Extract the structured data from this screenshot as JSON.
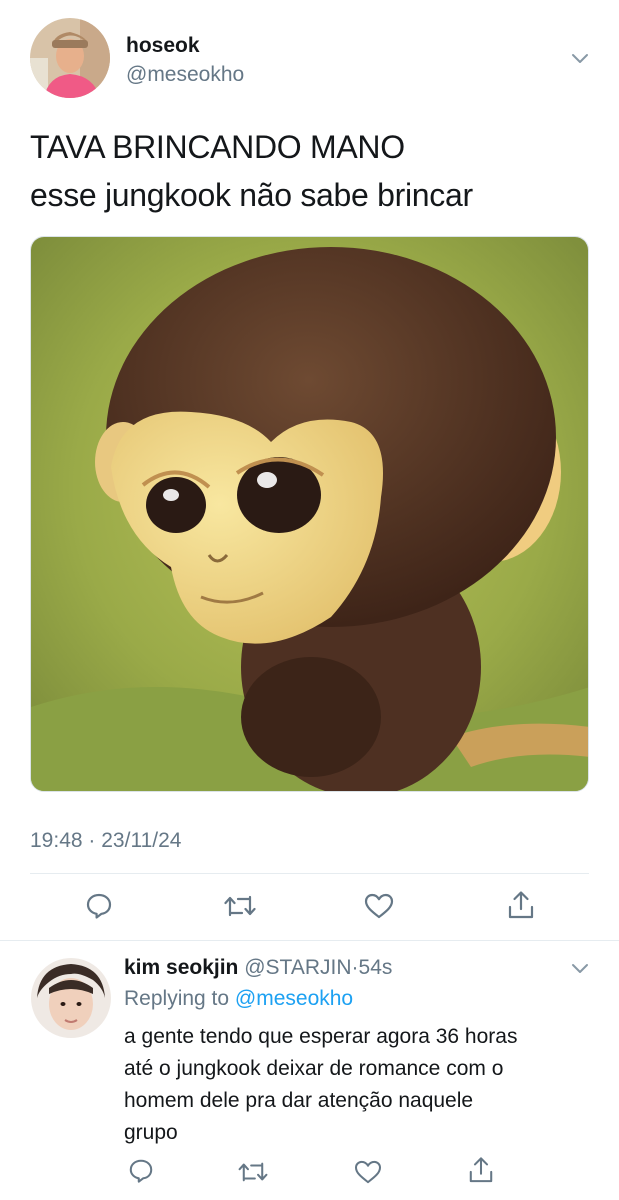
{
  "tweet": {
    "author_name": "hoseok",
    "author_handle": "@meseokho",
    "text_line1": "TAVA BRINCANDO MANO",
    "text_line2": "esse jungkook não sabe brincar",
    "time": "19:48",
    "separator": "·",
    "date": "23/11/24",
    "actions": [
      "reply-icon",
      "retweet-icon",
      "like-icon",
      "share-icon"
    ]
  },
  "reply": {
    "author_name": "kim seokjin",
    "author_handle": "@STARJIN",
    "separator": "·",
    "time_ago": "54s",
    "replying_prefix": "Replying to",
    "replying_handle": "@meseokho",
    "text_lines": [
      "a gente tendo que esperar agora 36 horas",
      "até o jungkook deixar de romance com o",
      "homem dele pra dar atenção naquele",
      "grupo"
    ],
    "actions": [
      "reply-icon",
      "retweet-icon",
      "like-icon",
      "share-icon"
    ]
  },
  "colors": {
    "text": "#14171a",
    "secondary": "#657786",
    "link": "#1da1f2",
    "divider": "#e6ecf0",
    "background": "#ffffff"
  }
}
